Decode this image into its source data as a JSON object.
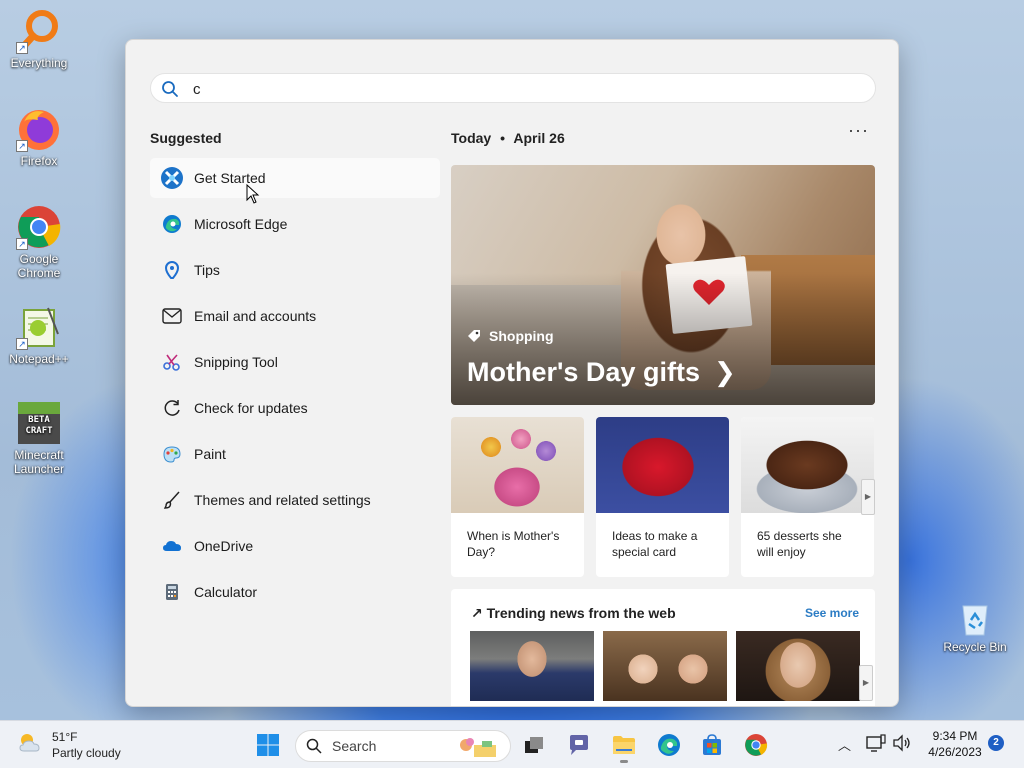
{
  "desktop": {
    "icons": [
      {
        "label": "Everything",
        "icon": "everything-magnifier-icon"
      },
      {
        "label": "Firefox",
        "icon": "firefox-icon"
      },
      {
        "label": "Google Chrome",
        "icon": "chrome-icon"
      },
      {
        "label": "Notepad++",
        "icon": "notepadpp-icon"
      },
      {
        "label": "Minecraft Launcher",
        "icon": "minecraft-icon"
      },
      {
        "label": "Recycle Bin",
        "icon": "recycle-bin-icon"
      }
    ]
  },
  "search_panel": {
    "query": "c",
    "suggested_title": "Suggested",
    "suggestions": [
      {
        "label": "Get Started",
        "icon": "get-started-icon"
      },
      {
        "label": "Microsoft Edge",
        "icon": "edge-icon"
      },
      {
        "label": "Tips",
        "icon": "tips-icon"
      },
      {
        "label": "Email and accounts",
        "icon": "mail-icon"
      },
      {
        "label": "Snipping Tool",
        "icon": "snipping-tool-icon"
      },
      {
        "label": "Check for updates",
        "icon": "refresh-icon"
      },
      {
        "label": "Paint",
        "icon": "paint-icon"
      },
      {
        "label": "Themes and related settings",
        "icon": "brush-icon"
      },
      {
        "label": "OneDrive",
        "icon": "onedrive-icon"
      },
      {
        "label": "Calculator",
        "icon": "calculator-icon"
      }
    ],
    "today_label": "Today",
    "date_label": "April 26",
    "more_label": "···",
    "hero": {
      "tag": "Shopping",
      "headline": "Mother's Day gifts"
    },
    "cards": [
      {
        "caption": "When is Mother's Day?"
      },
      {
        "caption": "Ideas to make a special card"
      },
      {
        "caption": "65 desserts she will enjoy"
      }
    ],
    "trending": {
      "title": "Trending news from the web",
      "see_more": "See more"
    }
  },
  "taskbar": {
    "weather": {
      "temp": "51°F",
      "condition": "Partly cloudy"
    },
    "search_label": "Search",
    "time": "9:34 PM",
    "date": "4/26/2023",
    "notification_count": "2"
  },
  "colors": {
    "accent": "#2c7cc4",
    "panel_bg": "#f2f2f2",
    "taskbar_bg": "#eef1f6"
  }
}
